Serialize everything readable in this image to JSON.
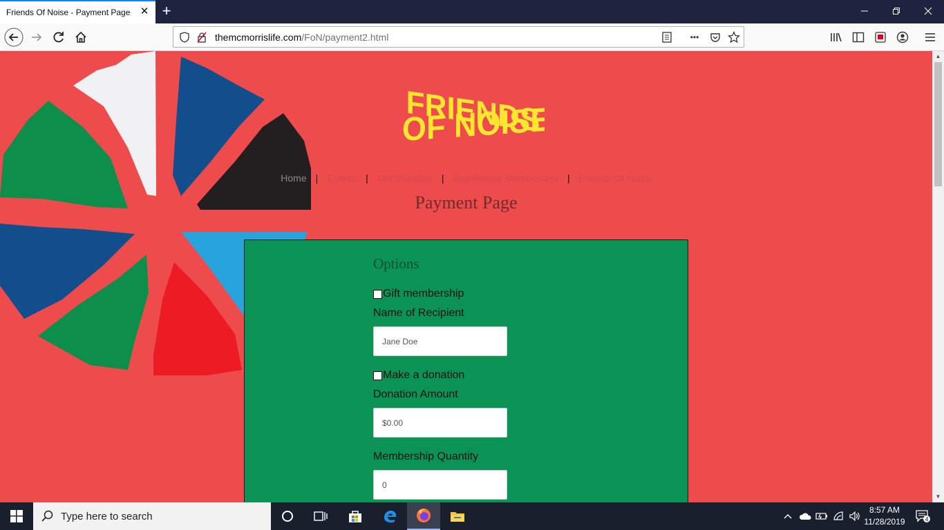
{
  "browser": {
    "tab_title": "Friends Of Noise - Payment Page",
    "tab_close": "✕",
    "new_tab": "+",
    "url_host": "themcmorrislife.com",
    "url_path": "/FoN/payment2.html",
    "more": "•••"
  },
  "site": {
    "logo_line1": "FRIENDS",
    "logo_line2": "OF NOISE",
    "nav": [
      "Home",
      "Events",
      "Merchandise",
      "Buy/Renew Membership",
      "Friends Of Noise"
    ],
    "nav_separator": "|",
    "page_title": "Payment Page"
  },
  "form": {
    "options_title": "Options",
    "gift_label": "Gift membership",
    "recipient_label": "Name of Recipient",
    "recipient_placeholder": "Jane Doe",
    "donation_label": "Make a donation",
    "donation_amount_label": "Donation Amount",
    "donation_placeholder": "$0.00",
    "quantity_label": "Membership Quantity",
    "quantity_placeholder": "0"
  },
  "taskbar": {
    "search_placeholder": "Type here to search",
    "time": "8:57 AM",
    "date": "11/28/2019",
    "notification_count": "4"
  },
  "colors": {
    "page_bg": "#ee4b4c",
    "panel_bg": "#0b9355",
    "logo_yellow": "#fde62f"
  }
}
